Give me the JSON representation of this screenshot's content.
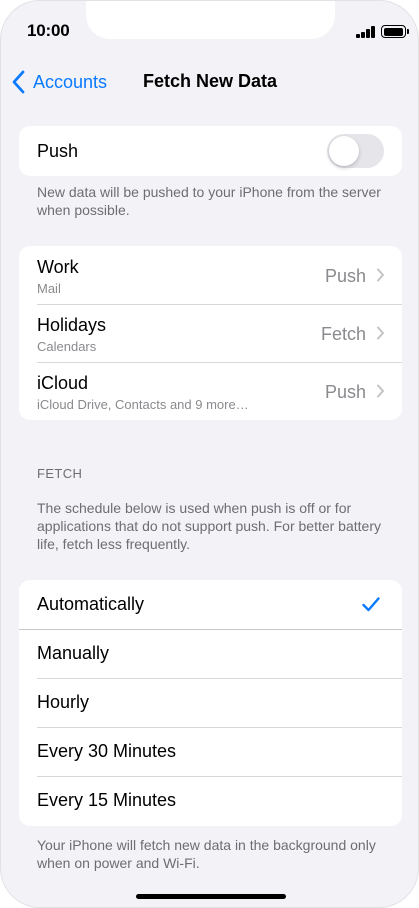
{
  "status_bar": {
    "time": "10:00"
  },
  "nav": {
    "back_label": "Accounts",
    "title": "Fetch New Data"
  },
  "push_group": {
    "label": "Push",
    "toggle_on": false,
    "footnote": "New data will be pushed to your iPhone from the server when possible."
  },
  "accounts": [
    {
      "name": "Work",
      "detail": "Mail",
      "mode": "Push"
    },
    {
      "name": "Holidays",
      "detail": "Calendars",
      "mode": "Fetch"
    },
    {
      "name": "iCloud",
      "detail": "iCloud Drive, Contacts and 9 more…",
      "mode": "Push"
    }
  ],
  "fetch_section": {
    "header": "FETCH",
    "description": "The schedule below is used when push is off or for applications that do not support push. For better battery life, fetch less frequently."
  },
  "schedule_options": [
    {
      "label": "Automatically",
      "selected": true
    },
    {
      "label": "Manually",
      "selected": false
    },
    {
      "label": "Hourly",
      "selected": false
    },
    {
      "label": "Every 30 Minutes",
      "selected": false
    },
    {
      "label": "Every 15 Minutes",
      "selected": false
    }
  ],
  "schedule_footnote": "Your iPhone will fetch new data in the background only when on power and Wi-Fi.",
  "colors": {
    "accent": "#0a7aff",
    "background": "#f2f2f7",
    "secondary_text": "#8a8a8e",
    "toggle_off": "#e5e5ea"
  }
}
